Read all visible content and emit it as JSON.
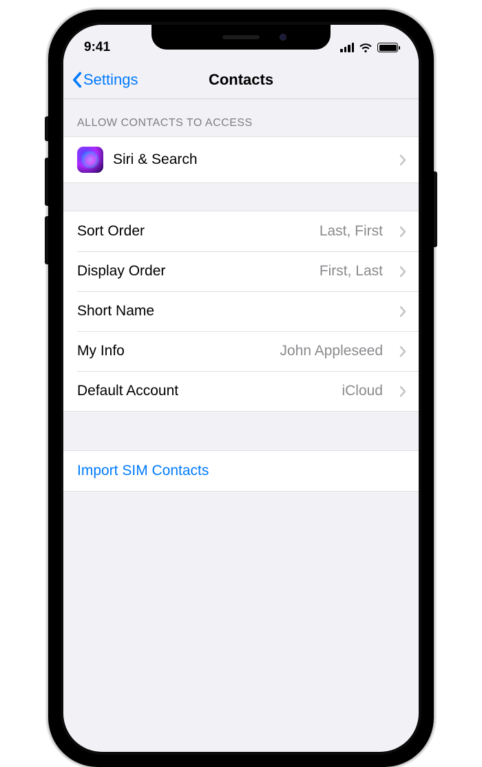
{
  "status": {
    "time": "9:41"
  },
  "nav": {
    "back": "Settings",
    "title": "Contacts"
  },
  "section_access": {
    "header": "Allow Contacts to Access",
    "siri_label": "Siri & Search"
  },
  "settings": {
    "sort_order": {
      "label": "Sort Order",
      "value": "Last, First"
    },
    "display_order": {
      "label": "Display Order",
      "value": "First, Last"
    },
    "short_name": {
      "label": "Short Name",
      "value": ""
    },
    "my_info": {
      "label": "My Info",
      "value": "John Appleseed"
    },
    "default_account": {
      "label": "Default Account",
      "value": "iCloud"
    }
  },
  "actions": {
    "import_sim": "Import SIM Contacts"
  }
}
